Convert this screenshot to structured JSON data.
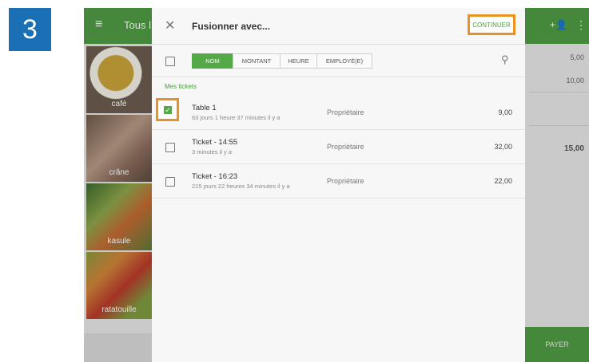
{
  "step_number": "3",
  "app": {
    "menu_icon": "≡",
    "title_partial": "Tous l",
    "add_person_icon": "+👤",
    "more_icon": "⋮",
    "tiles": [
      "café",
      "crâne",
      "kasule",
      "ratatouille"
    ],
    "amounts": [
      "5,00",
      "10,00"
    ],
    "total": "15,00",
    "pay_label": "PAYER"
  },
  "dialog": {
    "close_icon": "✕",
    "title": "Fusionner avec...",
    "continue_label": "CONTINUER",
    "tabs": [
      {
        "label": "NOM",
        "active": true
      },
      {
        "label": "MONTANT",
        "active": false
      },
      {
        "label": "HEURE",
        "active": false
      },
      {
        "label": "EMPLOYÉ(E)",
        "active": false
      }
    ],
    "search_icon": "⚲",
    "section_label": "Mes tickets",
    "tickets": [
      {
        "name": "Table 1",
        "sub": "63 jours 1 heure 37 minutes il y a",
        "owner": "Propriétaire",
        "amount": "9,00",
        "checked": true
      },
      {
        "name": "Ticket - 14:55",
        "sub": "3 minutes il y a",
        "owner": "Propriétaire",
        "amount": "32,00",
        "checked": false
      },
      {
        "name": "Ticket - 16:23",
        "sub": "215 jours 22 heures 34 minutes il y a",
        "owner": "Propriétaire",
        "amount": "22,00",
        "checked": false
      }
    ]
  },
  "colors": {
    "accent_green": "#4f9a44",
    "highlight_orange": "#e8921f",
    "badge_blue": "#1a6fb5"
  }
}
